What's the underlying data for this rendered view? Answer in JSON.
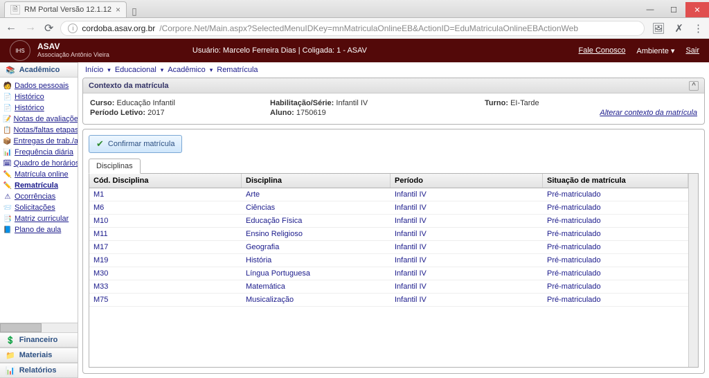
{
  "browser": {
    "tab_title": "RM Portal Versão 12.1.12",
    "url_host": "cordoba.asav.org.br",
    "url_path": "/Corpore.Net/Main.aspx?SelectedMenuIDKey=mnMatriculaOnlineEB&ActionID=EduMatriculaOnlineEBActionWeb"
  },
  "header": {
    "org_name": "ASAV",
    "org_sub": "Associação Antônio Vieira",
    "user_line": "Usuário: Marcelo Ferreira Dias  |  Coligada: 1 - ASAV",
    "fale_conosco": "Fale Conosco",
    "ambiente": "Ambiente",
    "sair": "Sair"
  },
  "breadcrumbs": [
    "Início",
    "Educacional",
    "Acadêmico",
    "Rematrícula"
  ],
  "sidebar": {
    "sections": {
      "academico": "Acadêmico",
      "financeiro": "Financeiro",
      "materiais": "Materiais",
      "relatorios": "Relatórios"
    },
    "items": [
      {
        "icon": "🧑",
        "label": "Dados pessoais"
      },
      {
        "icon": "📄",
        "label": "Histórico"
      },
      {
        "icon": "📄",
        "label": "Histórico"
      },
      {
        "icon": "📝",
        "label": "Notas de avaliações"
      },
      {
        "icon": "📋",
        "label": "Notas/faltas etapas"
      },
      {
        "icon": "📦",
        "label": "Entregas de trab./a"
      },
      {
        "icon": "📊",
        "label": "Frequência diária"
      },
      {
        "icon": "🗓",
        "label": "Quadro de horários"
      },
      {
        "icon": "✏️",
        "label": "Matrícula online"
      },
      {
        "icon": "✏️",
        "label": "Rematrícula",
        "bold": true
      },
      {
        "icon": "⚠",
        "label": "Ocorrências"
      },
      {
        "icon": "📨",
        "label": "Solicitações"
      },
      {
        "icon": "📑",
        "label": "Matriz curricular"
      },
      {
        "icon": "📘",
        "label": "Plano de aula"
      }
    ]
  },
  "context_panel": {
    "title": "Contexto da matrícula",
    "curso_label": "Curso:",
    "curso_value": "Educação Infantil",
    "habilitacao_label": "Habilitação/Série:",
    "habilitacao_value": "Infantil IV",
    "turno_label": "Turno:",
    "turno_value": "EI-Tarde",
    "periodo_label": "Período Letivo:",
    "periodo_value": "2017",
    "aluno_label": "Aluno:",
    "aluno_value": "1750619",
    "change_link": "Alterar contexto da matrícula"
  },
  "actions": {
    "confirm": "Confirmar matrícula"
  },
  "tabs": {
    "disciplinas": "Disciplinas"
  },
  "grid": {
    "headers": {
      "cod": "Cód. Disciplina",
      "disc": "Disciplina",
      "periodo": "Período",
      "situacao": "Situação de matrícula"
    },
    "rows": [
      {
        "cod": "M1",
        "disc": "Arte",
        "periodo": "Infantil IV",
        "situacao": "Pré-matriculado"
      },
      {
        "cod": "M6",
        "disc": "Ciências",
        "periodo": "Infantil IV",
        "situacao": "Pré-matriculado"
      },
      {
        "cod": "M10",
        "disc": "Educação Física",
        "periodo": "Infantil IV",
        "situacao": "Pré-matriculado"
      },
      {
        "cod": "M11",
        "disc": "Ensino Religioso",
        "periodo": "Infantil IV",
        "situacao": "Pré-matriculado"
      },
      {
        "cod": "M17",
        "disc": "Geografia",
        "periodo": "Infantil IV",
        "situacao": "Pré-matriculado"
      },
      {
        "cod": "M19",
        "disc": "História",
        "periodo": "Infantil IV",
        "situacao": "Pré-matriculado"
      },
      {
        "cod": "M30",
        "disc": "Língua Portuguesa",
        "periodo": "Infantil IV",
        "situacao": "Pré-matriculado"
      },
      {
        "cod": "M33",
        "disc": "Matemática",
        "periodo": "Infantil IV",
        "situacao": "Pré-matriculado"
      },
      {
        "cod": "M75",
        "disc": "Musicalização",
        "periodo": "Infantil IV",
        "situacao": "Pré-matriculado"
      }
    ]
  }
}
